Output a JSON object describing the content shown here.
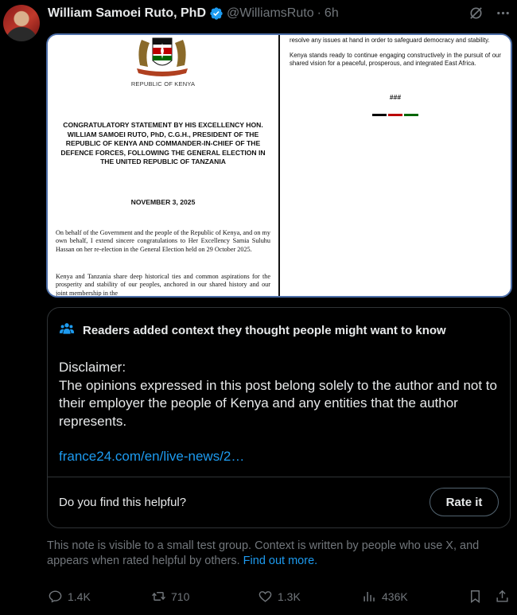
{
  "tweet": {
    "author_name": "William Samoei Ruto, PhD",
    "handle": "@WilliamsRuto",
    "separator": "·",
    "time": "6h"
  },
  "document": {
    "motto": "HARAMBEE",
    "republic": "REPUBLIC OF KENYA",
    "title": "CONGRATULATORY STATEMENT BY HIS EXCELLENCY HON. WILLIAM SAMOEI RUTO, PhD, C.G.H., PRESIDENT OF THE REPUBLIC OF KENYA AND COMMANDER-IN-CHIEF OF THE DEFENCE FORCES, FOLLOWING THE GENERAL ELECTION IN THE UNITED REPUBLIC OF TANZANIA",
    "date": "NOVEMBER 3, 2025",
    "para1": "On behalf of the Government and the people of the Republic of Kenya, and on my own behalf, I extend sincere congratulations to Her Excellency Samia Suluhu Hassan on her re-election in the General Election held on 29 October 2025.",
    "para2": "Kenya and Tanzania share deep historical ties and common aspirations for the prosperity and stability of our peoples, anchored in our shared history and our joint membership in the",
    "right_para1": "resolve any issues at hand in order to safeguard democracy and stability.",
    "right_para2": "Kenya stands ready to continue engaging constructively in the pursuit of our shared vision for a peaceful, prosperous, and integrated East Africa.",
    "end_mark": "###",
    "flag_colors": [
      "#000000",
      "#bb0000",
      "#006600"
    ]
  },
  "note": {
    "title": "Readers added context they thought people might want to know",
    "body": "Disclaimer:\nThe opinions expressed in this post belong solely to the author and not to their employer the people of Kenya and any entities that the author represents.",
    "link": "france24.com/en/live-news/2…",
    "helpful_question": "Do you find this helpful?",
    "rate_button": "Rate it",
    "footnote": "This note is visible to a small test group. Context is written by people who use X, and appears when rated helpful by others.",
    "find_out_more": "Find out more."
  },
  "actions": {
    "replies": "1.4K",
    "reposts": "710",
    "likes": "1.3K",
    "views": "436K"
  },
  "colors": {
    "background": "#000000",
    "text": "#e7e9ea",
    "muted": "#71767b",
    "accent": "#1d9bf0",
    "verified": "#1d9bf0",
    "media_border": "#4c6ea8"
  }
}
